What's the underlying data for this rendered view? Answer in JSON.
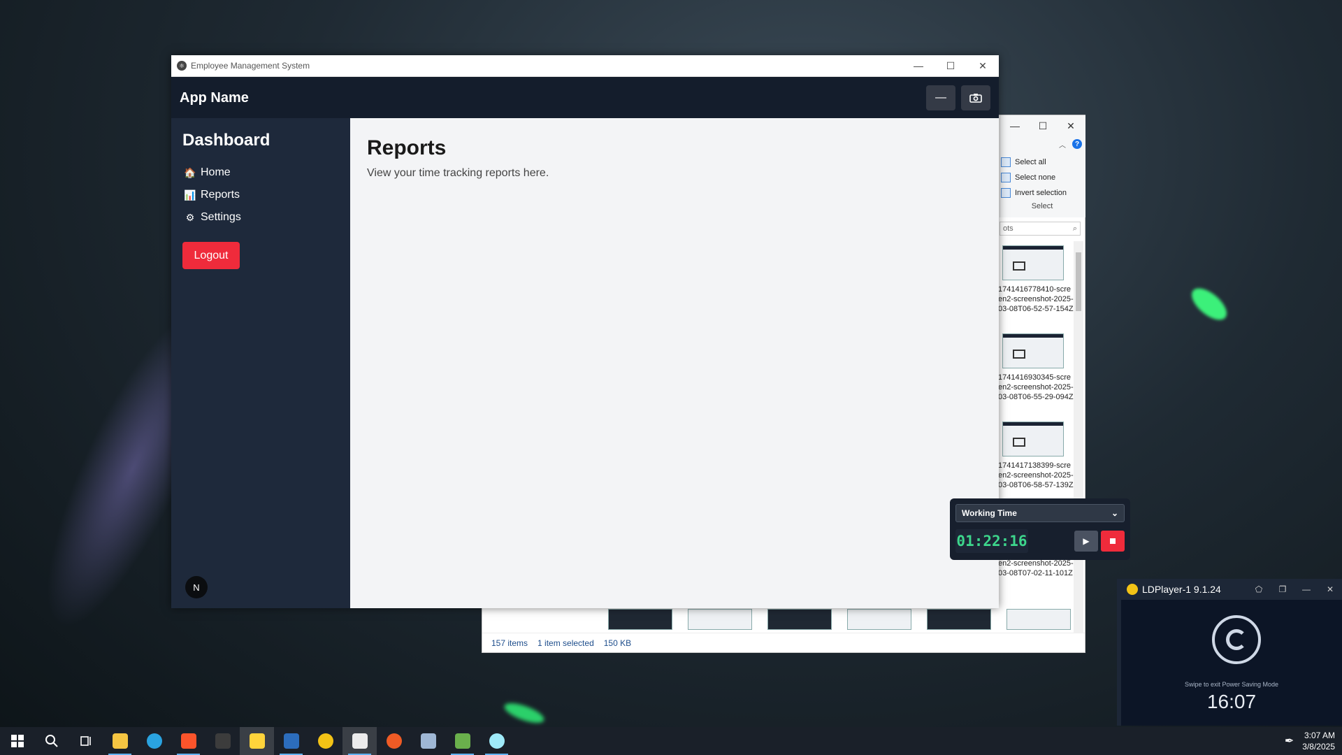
{
  "explorer": {
    "select_all": "Select all",
    "select_none": "Select none",
    "invert_selection": "Invert selection",
    "select_group": "Select",
    "search_text": "ots",
    "files": [
      {
        "name": "1741416778410-screen2-screenshot-2025-03-08T06-52-57-154Z"
      },
      {
        "name": "1741416930345-screen2-screenshot-2025-03-08T06-55-29-094Z"
      },
      {
        "name": "1741417138399-screen2-screenshot-2025-03-08T06-58-57-139Z"
      },
      {
        "name": "1741417332354-screen2-screenshot-2025-03-08T07-02-11-101Z"
      }
    ],
    "status_items": "157 items",
    "status_selected": "1 item selected",
    "status_size": "150 KB"
  },
  "window": {
    "title": "Employee Management System"
  },
  "header": {
    "brand": "App Name"
  },
  "sidebar": {
    "title": "Dashboard",
    "items": [
      {
        "icon": "home-icon",
        "glyph": "🏠",
        "label": "Home"
      },
      {
        "icon": "chart-icon",
        "glyph": "📊",
        "label": "Reports"
      },
      {
        "icon": "gear-icon",
        "glyph": "⚙",
        "label": "Settings"
      }
    ],
    "logout_label": "Logout",
    "avatar_letter": "N"
  },
  "main": {
    "heading": "Reports",
    "description": "View your time tracking reports here."
  },
  "timer": {
    "mode_selected": "Working Time",
    "elapsed": "01:22:16"
  },
  "ldplayer": {
    "title": "LDPlayer-1 9.1.24",
    "power_saving": "Swipe to exit Power Saving Mode",
    "clock": "16:07"
  },
  "taskbar": {
    "time": "3:07 AM",
    "date": "3/8/2025",
    "apps": [
      {
        "name": "file-explorer-icon",
        "color": "#f5c542"
      },
      {
        "name": "edge-icon",
        "color": "#2aa3e0"
      },
      {
        "name": "brave-icon",
        "color": "#fb542b"
      },
      {
        "name": "terminal-icon",
        "color": "#3c3c3c"
      },
      {
        "name": "sticky-notes-icon",
        "color": "#ffd43b"
      },
      {
        "name": "screenshot-tool-icon",
        "color": "#2c6dbd"
      },
      {
        "name": "ldplayer-icon",
        "color": "#f3c316"
      },
      {
        "name": "app-icon",
        "color": "#ececec"
      },
      {
        "name": "postman-icon",
        "color": "#ef5b25"
      },
      {
        "name": "mail-icon",
        "color": "#9fb7d4"
      },
      {
        "name": "notepad-icon",
        "color": "#6ab04c"
      },
      {
        "name": "electron-icon",
        "color": "#9feaf9"
      }
    ]
  },
  "colors": {
    "accent_red": "#ef2b3b",
    "timer_green": "#3dd68c",
    "sidebar_bg": "#1e293b",
    "header_bg": "#141d2c"
  }
}
